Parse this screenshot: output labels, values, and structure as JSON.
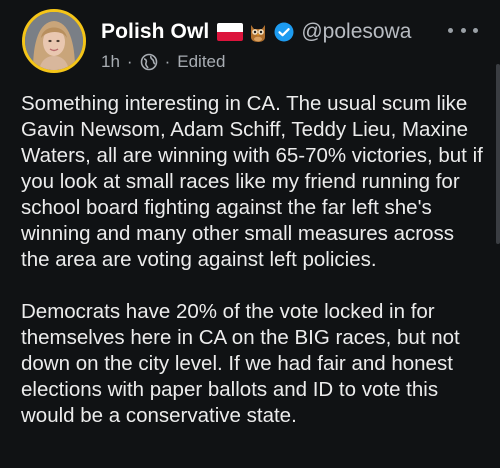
{
  "post": {
    "author": {
      "display_name": "Polish Owl",
      "handle": "@polesowa",
      "flag_icon": "poland-flag-icon",
      "emoji_icon": "owl-icon",
      "verified_icon": "verified-badge-icon"
    },
    "meta": {
      "time": "1h",
      "separator": "·",
      "audience_icon": "globe-icon",
      "edited": "Edited"
    },
    "menu_icon": "more-options-icon",
    "paragraphs": [
      "Something interesting in CA. The usual scum like Gavin Newsom, Adam Schiff, Teddy Lieu, Maxine Waters, all are winning with 65-70% victories, but if you look at small races like my friend running for school board fighting against the far left she's winning and many other small measures across the area are voting against left policies.",
      "Democrats have 20% of the vote locked in for themselves here in CA on the BIG races, but not down on the city level. If we had fair and honest elections with paper ballots and ID to vote this would be a conservative state."
    ]
  },
  "colors": {
    "background": "#101214",
    "text": "#ececec",
    "secondary_text": "#a8adb3",
    "avatar_ring": "#f5c518",
    "verified": "#1d9bf0"
  }
}
